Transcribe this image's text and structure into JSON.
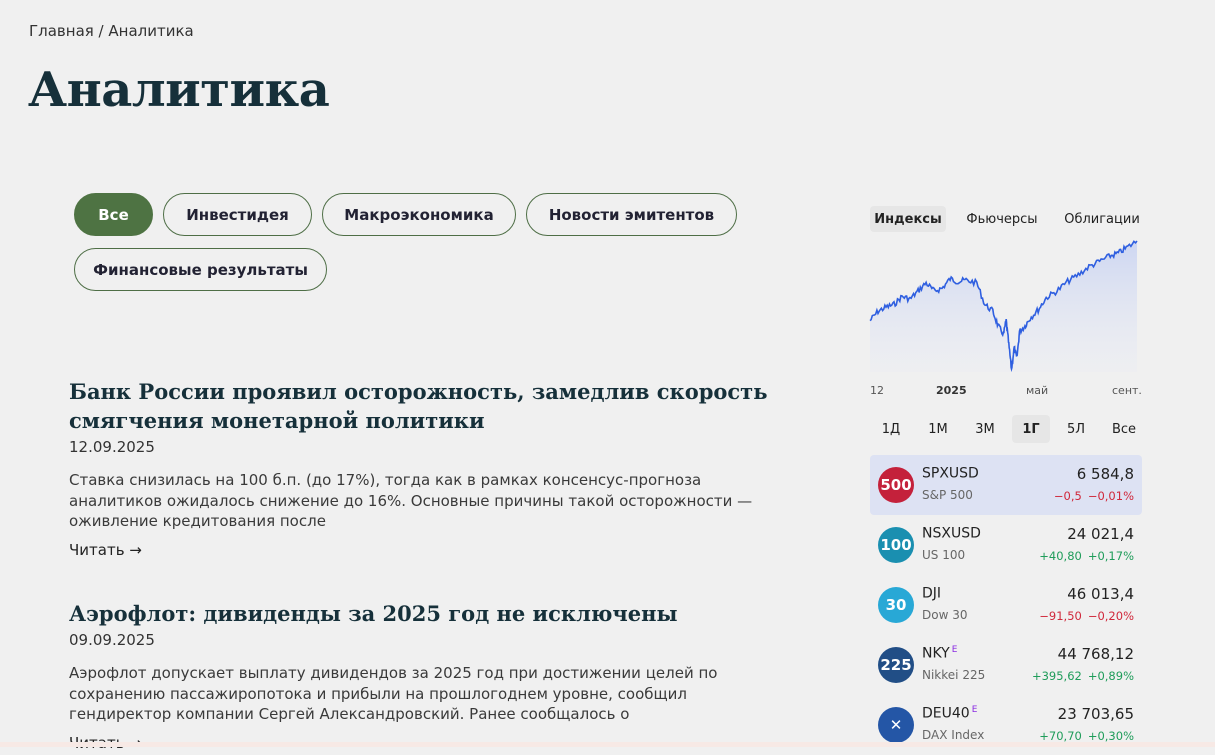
{
  "breadcrumb": "Главная / Аналитика",
  "page_title": "Аналитика",
  "filters": [
    "Все",
    "Инвестидея",
    "Макроэкономика",
    "Новости эмитентов",
    "Финансовые результаты"
  ],
  "active_filter": "Все",
  "articles": [
    {
      "title": "Банк России проявил осторожность, замедлив скорость смягчения монетарной политики",
      "date": "12.09.2025",
      "excerpt": "Ставка снизилась на 100 б.п. (до 17%), тогда как в рамках консенсус-прогноза аналитиков ожидалось снижение до 16%. Основные причины такой осторожности — оживление кредитования после",
      "read_label": "Читать →"
    },
    {
      "title": "Аэрофлот: дивиденды за 2025 год не исключены",
      "date": "09.09.2025",
      "excerpt": "Аэрофлот допускает выплату дивидендов за 2025 год при достижении целей по сохранению пассажиропотока и прибыли на прошлогоднем уровне, сообщил гендиректор компании Сергей Александровский. Ранее сообщалось о",
      "read_label": "Читать →"
    }
  ],
  "market_widget": {
    "tabs": [
      "Индексы",
      "Фьючерсы",
      "Облигации"
    ],
    "active_tab": "Индексы",
    "x_labels": [
      "12",
      "2025",
      "май",
      "сент."
    ],
    "periods": [
      "1Д",
      "1М",
      "3М",
      "1Г",
      "5Л",
      "Все"
    ],
    "active_period": "1Г",
    "line_color": "#2f5fe0",
    "quotes": [
      {
        "badge": "500",
        "badge_color": "#c4213b",
        "ticker": "SPXUSD",
        "exchange_mark": "",
        "name": "S&P 500",
        "price": "6 584,8",
        "change": "−0,5",
        "change_pct": "−0,01%",
        "direction": "neg",
        "selected": true
      },
      {
        "badge": "100",
        "badge_color": "#1a8fb0",
        "ticker": "NSXUSD",
        "exchange_mark": "",
        "name": "US 100",
        "price": "24 021,4",
        "change": "+40,80",
        "change_pct": "+0,17%",
        "direction": "pos",
        "selected": false
      },
      {
        "badge": "30",
        "badge_color": "#28a8d6",
        "ticker": "DJI",
        "exchange_mark": "",
        "name": "Dow 30",
        "price": "46 013,4",
        "change": "−91,50",
        "change_pct": "−0,20%",
        "direction": "neg",
        "selected": false
      },
      {
        "badge": "225",
        "badge_color": "#214e86",
        "ticker": "NKY",
        "exchange_mark": "E",
        "name": "Nikkei 225",
        "price": "44 768,12",
        "change": "+395,62",
        "change_pct": "+0,89%",
        "direction": "pos",
        "selected": false
      },
      {
        "badge": "✕",
        "badge_color": "#2456a6",
        "ticker": "DEU40",
        "exchange_mark": "E",
        "name": "DAX Index",
        "price": "23 703,65",
        "change": "+70,70",
        "change_pct": "+0,30%",
        "direction": "pos",
        "selected": false
      }
    ]
  }
}
